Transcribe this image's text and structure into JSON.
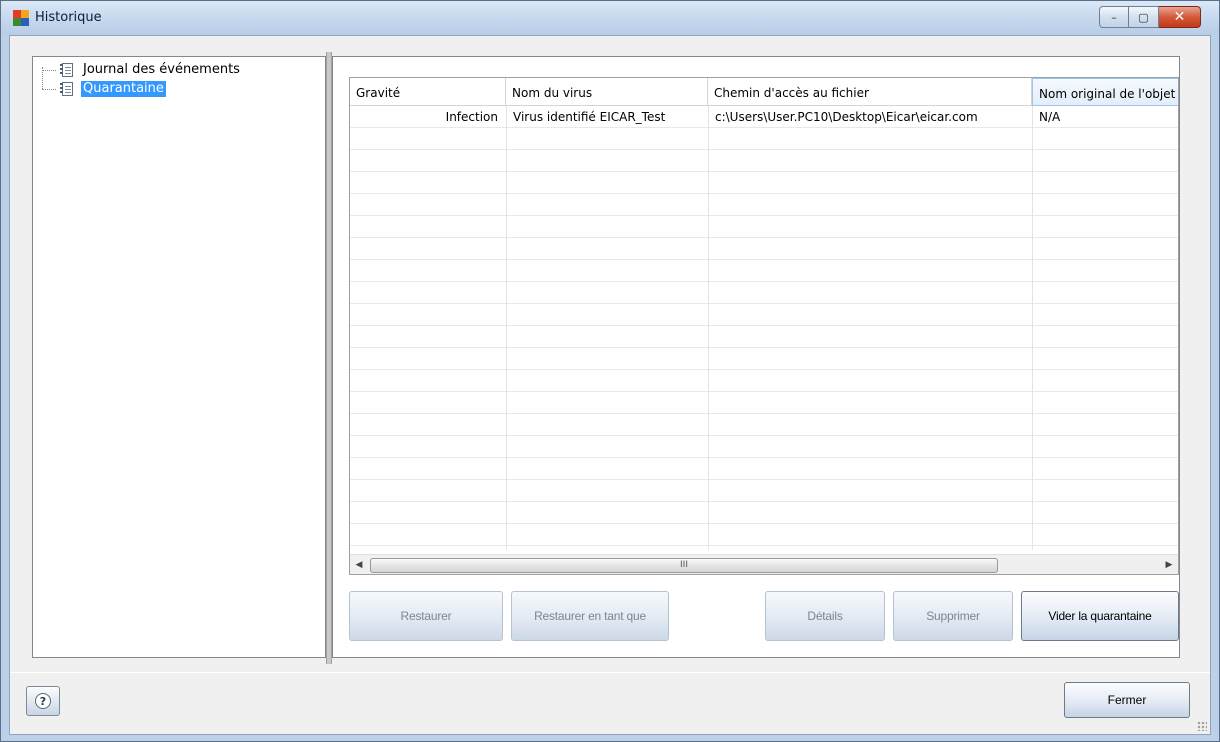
{
  "window": {
    "title": "Historique",
    "controls": {
      "minimize": "–",
      "maximize": "▢",
      "close": "✕"
    }
  },
  "tree": {
    "items": [
      {
        "label": "Journal des événements",
        "selected": false
      },
      {
        "label": "Quarantaine",
        "selected": true
      }
    ]
  },
  "table": {
    "columns": [
      "Gravité",
      "Nom du virus",
      "Chemin d'accès au fichier",
      "Nom original de l'objet"
    ],
    "rows": [
      [
        "Infection",
        "Virus identifié EICAR_Test",
        "c:\\Users\\User.PC10\\Desktop\\Eicar\\eicar.com",
        "N/A"
      ]
    ],
    "scroll": {
      "left_arrow": "◀",
      "right_arrow": "▶",
      "thumb_grip": "III"
    }
  },
  "actions": {
    "restore": "Restaurer",
    "restore_as": "Restaurer en tant que",
    "details": "Détails",
    "delete": "Supprimer",
    "empty_quarantine": "Vider la quarantaine"
  },
  "footer": {
    "help": "?",
    "close": "Fermer"
  },
  "colors": {
    "selection": "#3399ff",
    "titlebar": "#c3d6ec",
    "close_button": "#d45a3c"
  },
  "icons": {
    "app": "avg-logo-icon",
    "tree_item": "document-log-icon",
    "help": "help-icon"
  }
}
